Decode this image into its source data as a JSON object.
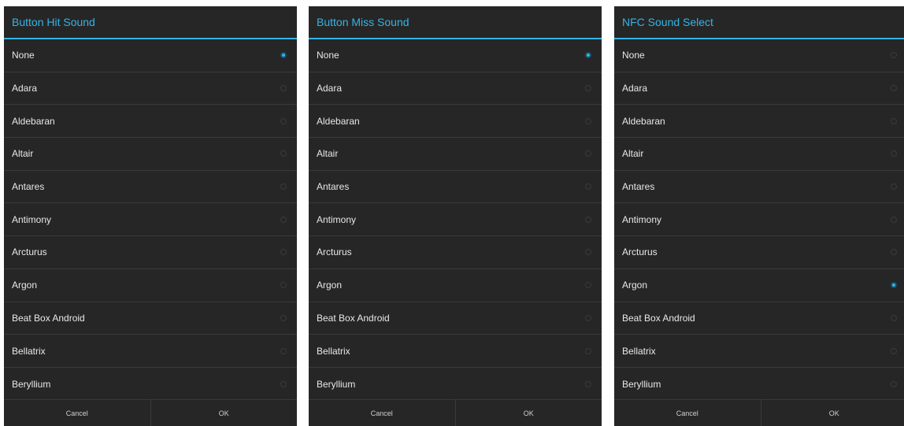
{
  "accent_color": "#33b5e5",
  "dialogs": [
    {
      "title": "Button Hit Sound",
      "selected": "None",
      "items": [
        "None",
        "Adara",
        "Aldebaran",
        "Altair",
        "Antares",
        "Antimony",
        "Arcturus",
        "Argon",
        "Beat Box Android",
        "Bellatrix",
        "Beryllium"
      ],
      "cancel_label": "Cancel",
      "ok_label": "OK"
    },
    {
      "title": "Button Miss Sound",
      "selected": "None",
      "items": [
        "None",
        "Adara",
        "Aldebaran",
        "Altair",
        "Antares",
        "Antimony",
        "Arcturus",
        "Argon",
        "Beat Box Android",
        "Bellatrix",
        "Beryllium"
      ],
      "cancel_label": "Cancel",
      "ok_label": "OK"
    },
    {
      "title": "NFC Sound Select",
      "selected": "Argon",
      "items": [
        "None",
        "Adara",
        "Aldebaran",
        "Altair",
        "Antares",
        "Antimony",
        "Arcturus",
        "Argon",
        "Beat Box Android",
        "Bellatrix",
        "Beryllium"
      ],
      "cancel_label": "Cancel",
      "ok_label": "OK"
    }
  ]
}
